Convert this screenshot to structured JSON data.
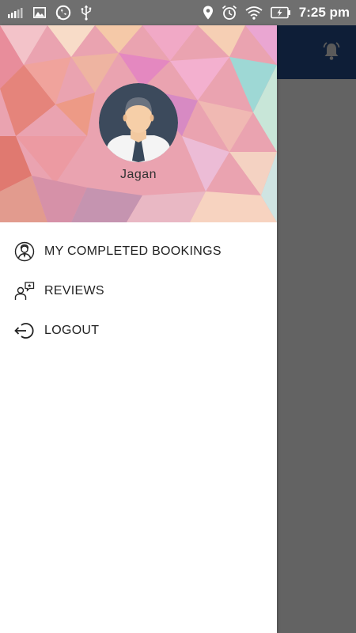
{
  "status_bar": {
    "time": "7:25 pm",
    "left_icons": [
      "signal-icon",
      "image-icon",
      "whatsapp-icon",
      "usb-icon"
    ],
    "right_icons": [
      "location-icon",
      "alarm-icon",
      "wifi-icon",
      "battery-icon"
    ]
  },
  "drawer": {
    "user_name": "Jagan",
    "menu": [
      {
        "label": "MY COMPLETED BOOKINGS",
        "icon": "user-profile-icon"
      },
      {
        "label": "REVIEWS",
        "icon": "reviews-icon"
      },
      {
        "label": "LOGOUT",
        "icon": "logout-icon"
      }
    ]
  },
  "app_bar": {
    "icon": "notification-bell-icon"
  },
  "colors": {
    "app_bar": "#0e1e37",
    "scrim": "#636363",
    "status_bar": "#6f6f6f",
    "drawer_bg": "#ffffff"
  }
}
